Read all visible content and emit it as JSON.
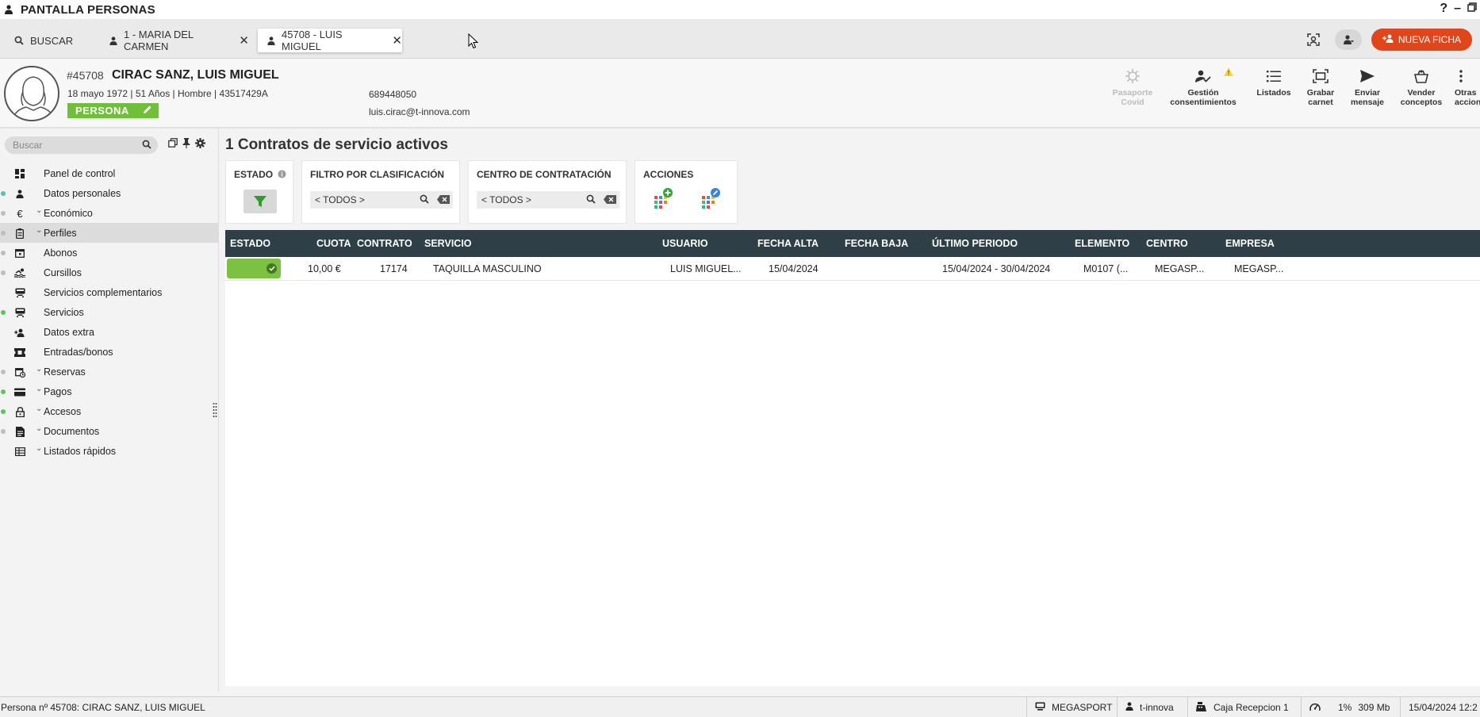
{
  "window": {
    "title": "PANTALLA PERSONAS"
  },
  "tabs": {
    "search_label": "BUSCAR",
    "items": [
      {
        "label": "1 - MARIA DEL CARMEN"
      },
      {
        "label": "45708 - LUIS MIGUEL"
      }
    ],
    "new_button": "NUEVA FICHA"
  },
  "person": {
    "id": "#45708",
    "name": "CIRAC SANZ, LUIS MIGUEL",
    "info": "18 mayo 1972 | 51 Años | Hombre | 43517429A",
    "badge": "PERSONA",
    "phone": "689448050",
    "email": "luis.cirac@t-innova.com"
  },
  "actions": [
    {
      "label": "Pasaporte\nCovid",
      "icon": "virus-icon",
      "disabled": true
    },
    {
      "label": "Gestión\nconsentimientos",
      "icon": "user-check-icon"
    },
    {
      "label": "Listados",
      "icon": "list-icon"
    },
    {
      "label": "Grabar\ncarnet",
      "icon": "card-scan-icon"
    },
    {
      "label": "Enviar\nmensaje",
      "icon": "send-icon"
    },
    {
      "label": "Vender\nconceptos",
      "icon": "basket-icon"
    },
    {
      "label": "Otras\nacciones",
      "icon": "more-vertical-icon"
    }
  ],
  "sidebar": {
    "search_placeholder": "Buscar",
    "items": [
      {
        "label": "Panel de control",
        "dot": "",
        "chevron": false
      },
      {
        "label": "Datos personales",
        "dot": "#5bbfb4",
        "chevron": false
      },
      {
        "label": "Económico",
        "dot": "#bdbdbd",
        "chevron": true
      },
      {
        "label": "Perfiles",
        "dot": "#bdbdbd",
        "chevron": true,
        "active": true
      },
      {
        "label": "Abonos",
        "dot": "#bdbdbd",
        "chevron": false
      },
      {
        "label": "Cursillos",
        "dot": "#bdbdbd",
        "chevron": false
      },
      {
        "label": "Servicios complementarios",
        "dot": "",
        "chevron": false
      },
      {
        "label": "Servicios",
        "dot": "#5cc55a",
        "chevron": false
      },
      {
        "label": "Datos extra",
        "dot": "",
        "chevron": false
      },
      {
        "label": "Entradas/bonos",
        "dot": "",
        "chevron": false
      },
      {
        "label": "Reservas",
        "dot": "#bdbdbd",
        "chevron": true
      },
      {
        "label": "Pagos",
        "dot": "#5cc55a",
        "chevron": true
      },
      {
        "label": "Accesos",
        "dot": "#5cc55a",
        "chevron": true
      },
      {
        "label": "Documentos",
        "dot": "#bdbdbd",
        "chevron": true
      },
      {
        "label": "Listados rápidos",
        "dot": "",
        "chevron": true
      }
    ]
  },
  "main": {
    "title": "1 Contratos de servicio activos",
    "filters": {
      "estado": "ESTADO",
      "clasificacion": "FILTRO POR CLASIFICACIÓN",
      "clasificacion_value": "< TODOS >",
      "centro": "CENTRO DE CONTRATACIÓN",
      "centro_value": "< TODOS >",
      "acciones": "ACCIONES"
    },
    "columns": [
      "ESTADO",
      "CUOTA",
      "CONTRATO",
      "SERVICIO",
      "USUARIO",
      "FECHA ALTA",
      "FECHA BAJA",
      "ÚLTIMO PERIODO",
      "ELEMENTO",
      "CENTRO",
      "EMPRESA"
    ],
    "rows": [
      {
        "estado": "active",
        "cuota": "10,00 €",
        "contrato": "17174",
        "servicio": "TAQUILLA MASCULINO",
        "usuario": "LUIS MIGUEL...",
        "fecha_alta": "15/04/2024",
        "fecha_baja": "",
        "ultimo_periodo": "15/04/2024 - 30/04/2024",
        "elemento": "M0107 (...",
        "centro": "MEGASP...",
        "empresa": "MEGASP..."
      }
    ]
  },
  "status": {
    "left": "Persona nº 45708: CIRAC SANZ, LUIS MIGUEL",
    "site": "MEGASPORT",
    "user": "t-innova",
    "register": "Caja Recepcion 1",
    "cpu": "1%",
    "memory": "309 Mb",
    "datetime": "15/04/2024 12:2"
  },
  "colors": {
    "accent": "#e0461c",
    "header_bg": "#2e3f47",
    "active_green": "#7cc142",
    "badge_green": "#6fbf3a"
  }
}
